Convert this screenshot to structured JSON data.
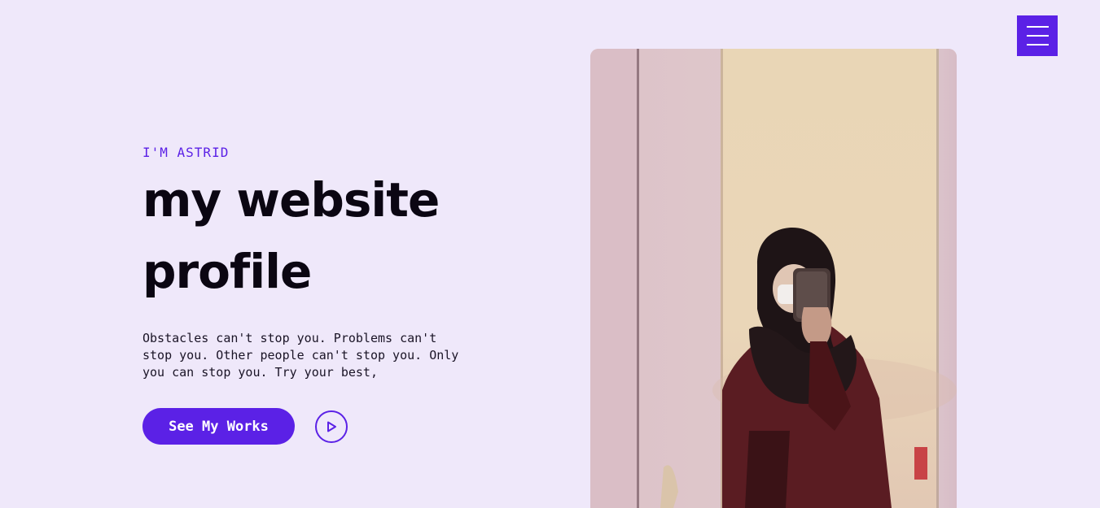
{
  "nav": {
    "menu_icon": "hamburger-icon"
  },
  "hero": {
    "kicker": "I'M ASTRID",
    "headline_line1": "my website",
    "headline_line2": "profile",
    "description": "Obstacles can't stop you. Problems can't stop you. Other people can't stop you. Only you can stop you. Try your best,",
    "cta_label": "See My Works",
    "play_icon": "play-circle-icon"
  },
  "photo": {
    "subject": "mirror-selfie-photo"
  },
  "colors": {
    "background": "#efe8fa",
    "accent": "#5b21e6",
    "text": "#0b0612"
  }
}
